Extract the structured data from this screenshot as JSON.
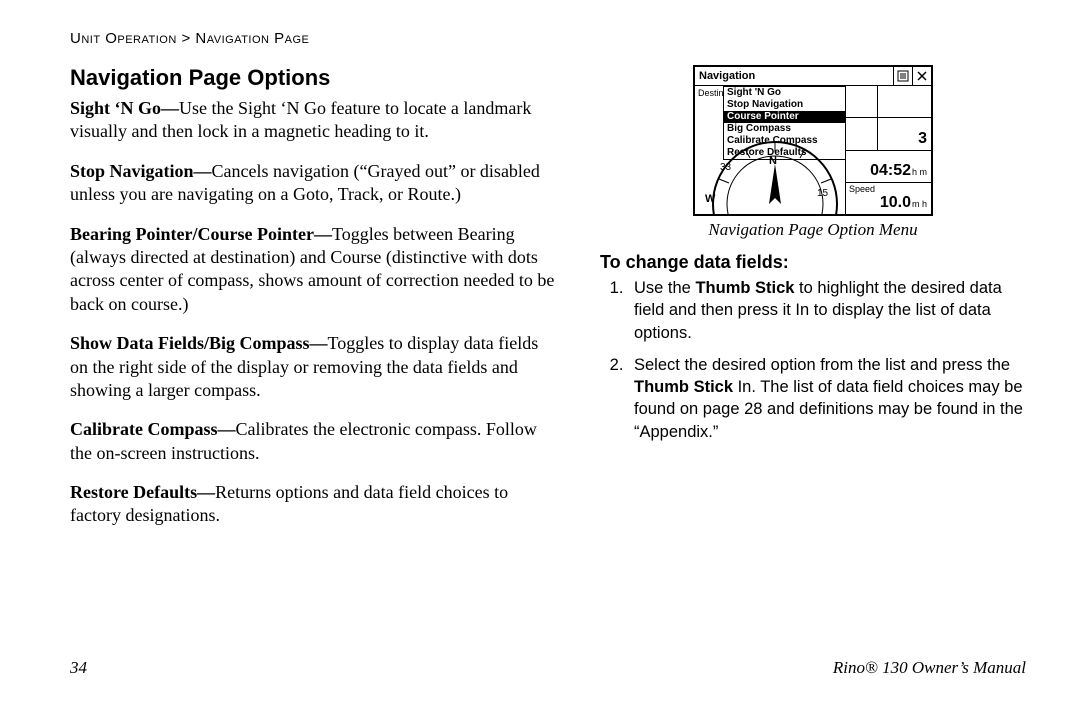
{
  "breadcrumb": "Unit Operation > Navigation Page",
  "section_title": "Navigation Page Options",
  "options": [
    {
      "term": "Sight ‘N Go—",
      "text": "Use the Sight ‘N Go feature to locate a landmark visually and then lock in a magnetic heading to it."
    },
    {
      "term": "Stop Navigation—",
      "text": "Cancels navigation (“Grayed out” or disabled unless you are navigating on a Goto, Track, or Route.)"
    },
    {
      "term": "Bearing Pointer/Course Pointer—",
      "text": "Toggles between Bearing (always directed at destination) and Course (distinctive with dots across center of compass, shows amount of correction needed to be back on course.)"
    },
    {
      "term": "Show Data Fields/Big Compass—",
      "text": "Toggles to display data fields on the right side of the display or removing the data fields and showing a larger compass."
    },
    {
      "term": "Calibrate Compass—",
      "text": "Calibrates the electronic compass. Follow the on-screen instructions."
    },
    {
      "term": "Restore Defaults—",
      "text": "Returns options and data field choices to factory designations."
    }
  ],
  "figure": {
    "titlebar": "Navigation",
    "destined_label": "Destind",
    "menu": {
      "items": [
        "Sight 'N Go",
        "Stop Navigation",
        "Course Pointer",
        "Big Compass",
        "Calibrate Compass",
        "Restore Defaults"
      ],
      "selected_index": 2
    },
    "compass_ticks": [
      "33",
      "N",
      "W",
      "15"
    ],
    "fields": [
      {
        "label": "",
        "value": "",
        "unit": ""
      },
      {
        "label": "",
        "value": "3",
        "unit": ""
      },
      {
        "label": "",
        "value": "04:52",
        "unit": "h m"
      },
      {
        "label": "Speed",
        "value": "10.0",
        "unit": "m h"
      }
    ],
    "caption": "Navigation Page Option Menu"
  },
  "right": {
    "subheading": "To change data fields:",
    "steps": [
      {
        "pre": "Use the ",
        "bold": "Thumb Stick",
        "post": " to highlight the desired data field and then press it In to display the list of data options."
      },
      {
        "pre": "Select the desired option from the list and press the ",
        "bold": "Thumb Stick",
        "post": " In. The list of data field choices may be found on page 28 and definitions may be found in the “Appendix.”"
      }
    ]
  },
  "footer": {
    "page": "34",
    "manual": "Rino® 130 Owner’s Manual"
  }
}
